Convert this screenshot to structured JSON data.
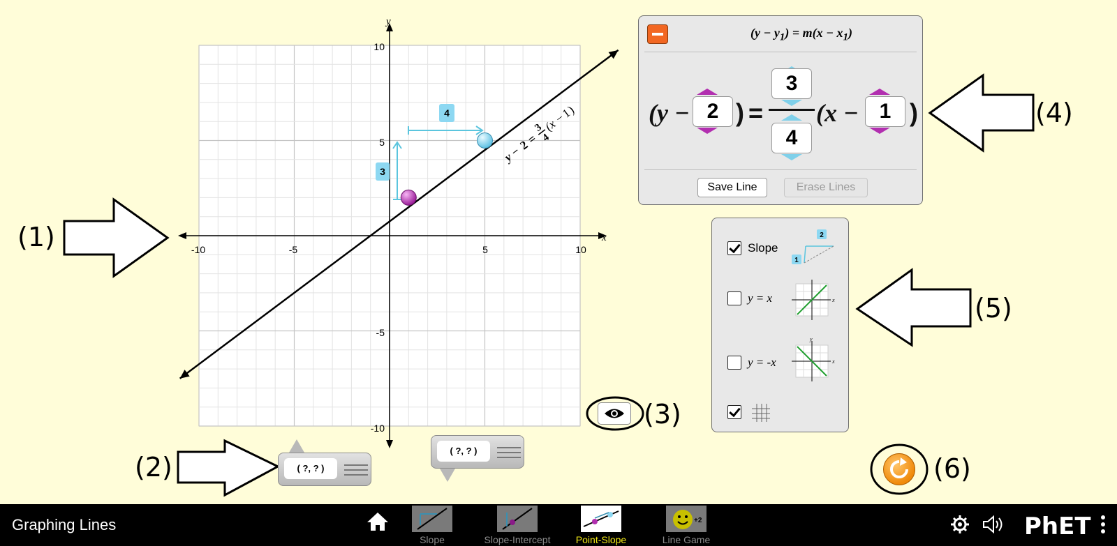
{
  "graph": {
    "x_axis_label": "x",
    "y_axis_label": "y",
    "x_tick_labels": [
      "-10",
      "-5",
      "5",
      "10"
    ],
    "y_tick_labels": [
      "10",
      "5",
      "-5",
      "-10"
    ],
    "line_label": {
      "y1": "2",
      "m_num": "3",
      "m_den": "4",
      "x1": "1"
    },
    "slope_indicator": {
      "rise": "3",
      "run": "4"
    },
    "colors": {
      "line": "#000000",
      "point1": "#B22FB0",
      "point2": "#8DD8F2",
      "slope_arrows": "#5BC5DE"
    }
  },
  "chart_data": {
    "type": "line",
    "x": [
      -11,
      12
    ],
    "y": [
      -7.5,
      9.75
    ],
    "equation": "y - 2 = 3/4(x - 1)",
    "points": [
      {
        "x": 1,
        "y": 2
      },
      {
        "x": 5,
        "y": 5
      }
    ],
    "xlabel": "x",
    "ylabel": "y",
    "xlim": [
      -10,
      10
    ],
    "ylim": [
      -10,
      10
    ],
    "grid": true
  },
  "equation_panel": {
    "title_parts": [
      "(y − y",
      "1",
      ") = m(x − x",
      "1",
      ")"
    ],
    "y_prefix": "(y −",
    "y1": "2",
    "close_paren": ")",
    "equals": "=",
    "x_prefix": "(x −",
    "x1": "1",
    "close_paren2": ")",
    "rise": "3",
    "run": "4",
    "save_button": "Save Line",
    "erase_button": "Erase Lines"
  },
  "options_panel": {
    "slope_label": "Slope",
    "slope_checked": true,
    "slope_icon_rise": "1",
    "slope_icon_run": "2",
    "yx_label": "y = x",
    "yx_checked": false,
    "ynegx_label": "y = -x",
    "ynegx_checked": false,
    "grid_checked": true,
    "icon_axis_x": "x",
    "icon_axis_y": "y"
  },
  "point_readouts": [
    {
      "value": "( ?, ? )"
    },
    {
      "value": "( ?, ? )"
    }
  ],
  "annotations": {
    "a1": "(1)",
    "a2": "(2)",
    "a3": "(3)",
    "a4": "(4)",
    "a5": "(5)",
    "a6": "(6)"
  },
  "navbar": {
    "title": "Graphing Lines",
    "screens": [
      {
        "label": "Slope",
        "active": false
      },
      {
        "label": "Slope-Intercept",
        "active": false
      },
      {
        "label": "Point-Slope",
        "active": true
      },
      {
        "label": "Line Game",
        "active": false
      }
    ],
    "line_game_badge": "+2",
    "logo_text": "PhET"
  }
}
